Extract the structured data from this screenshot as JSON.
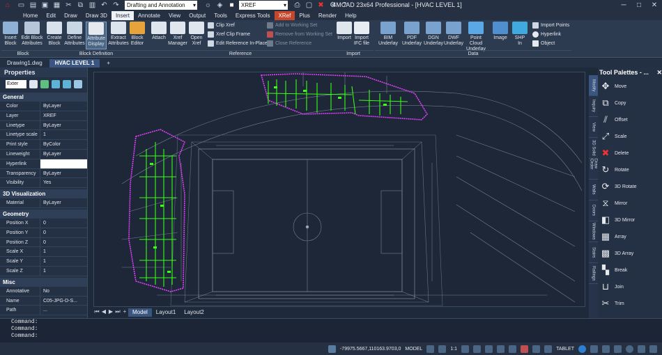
{
  "title_bar": {
    "app_title": "4MCAD 23x64 Professional - [HVAC LEVEL 1]",
    "workspace": "Drafting and Annotation",
    "layer": "XREF"
  },
  "menu": {
    "tabs": [
      "Home",
      "Edit",
      "Draw",
      "Draw 3D",
      "Insert",
      "Annotate",
      "View",
      "Output",
      "Tools",
      "Express Tools",
      "XRef",
      "Plus",
      "Render",
      "Help"
    ],
    "active": "Insert"
  },
  "ribbon": {
    "block": {
      "insert_block": "Insert Block",
      "edit_block_attributes": "Edit Block Attributes",
      "group": "Block"
    },
    "block_definition": {
      "create_block": "Create Block",
      "define_attributes": "Define Attributes",
      "attribute_display": "Attribute Display",
      "extract_attributes": "Extract Attributes",
      "block_editor": "Block Editor",
      "group": "Block Definition"
    },
    "reference": {
      "attach": "Attach",
      "xref_manager": "Xref Manager",
      "open_xref": "Open Xref",
      "clip_xref": "Clip Xref",
      "xref_clip_frame": "Xref Clip Frame",
      "edit_reference_in_place": "Edit Reference In-Place",
      "add_to_working_set": "Add to Working Set",
      "remove_from_working_set": "Remove from Working Set",
      "close_reference": "Close Reference",
      "group": "Reference"
    },
    "import": {
      "import": "Import",
      "import_ifc_file": "Import IFC file",
      "group": "Import"
    },
    "data": {
      "bim_underlay": "BIM Underlay",
      "pdf_underlay": "PDF Underlay",
      "dgn_underlay": "DGN Underlay",
      "dwf_underlay": "DWF Underlay",
      "point_cloud_underlay": "Point Cloud Underlay",
      "image": "Image",
      "shp_in": "SHP In",
      "import_points": "Import Points",
      "hyperlink": "Hyperlink",
      "object": "Object",
      "group": "Data"
    }
  },
  "doc_tabs": {
    "tabs": [
      "Drawing1.dwg",
      "HVAC LEVEL 1"
    ],
    "active": "HVAC LEVEL 1"
  },
  "properties": {
    "title": "Properties",
    "selector": "Exter",
    "sections": [
      {
        "name": "General",
        "rows": [
          [
            "Color",
            "ByLayer"
          ],
          [
            "Layer",
            "XREF"
          ],
          [
            "Linetype",
            "ByLayer"
          ],
          [
            "Linetype scale",
            "1"
          ],
          [
            "Print style",
            "ByColor"
          ],
          [
            "Lineweight",
            "ByLayer"
          ],
          [
            "Hyperlink",
            ""
          ],
          [
            "Transparency",
            "ByLayer"
          ],
          [
            "Visibility",
            "Yes"
          ]
        ]
      },
      {
        "name": "3D Visualization",
        "rows": [
          [
            "Material",
            "ByLayer"
          ]
        ]
      },
      {
        "name": "Geometry",
        "rows": [
          [
            "Position X",
            "0"
          ],
          [
            "Position Y",
            "0"
          ],
          [
            "Position Z",
            "0"
          ],
          [
            "Scale X",
            "1"
          ],
          [
            "Scale Y",
            "1"
          ],
          [
            "Scale Z",
            "1"
          ]
        ]
      },
      {
        "name": "Misc",
        "rows": [
          [
            "Annotative",
            "No"
          ],
          [
            "Name",
            "C05-JPG-D-S..."
          ],
          [
            "Path",
            "..."
          ]
        ]
      }
    ]
  },
  "layout_tabs": {
    "tabs": [
      "Model",
      "Layout1",
      "Layout2"
    ],
    "active": "Model"
  },
  "side_tabs": [
    "Modify",
    "Inquiry",
    "View",
    "3D Solid",
    "Draw Order",
    "Walls",
    "Doors",
    "Windows",
    "Stairs",
    "Railings"
  ],
  "tool_palette": {
    "title": "Tool Palettes - ...",
    "items": [
      "Move",
      "Copy",
      "Offset",
      "Scale",
      "Delete",
      "Rotate",
      "3D Rotate",
      "Mirror",
      "3D Mirror",
      "Array",
      "3D Array",
      "Break",
      "Join",
      "Trim"
    ]
  },
  "command": {
    "lines": [
      "Command:",
      "Command:",
      "Command:"
    ]
  },
  "status": {
    "coords": "-79975.5667,110163.9703,0",
    "mode": "MODEL",
    "scale": "1:1",
    "tablet": "TABLET"
  },
  "colors": {
    "xref_active": "#c6472c",
    "selected": "#e040fb",
    "ducts": "#39ff14"
  }
}
